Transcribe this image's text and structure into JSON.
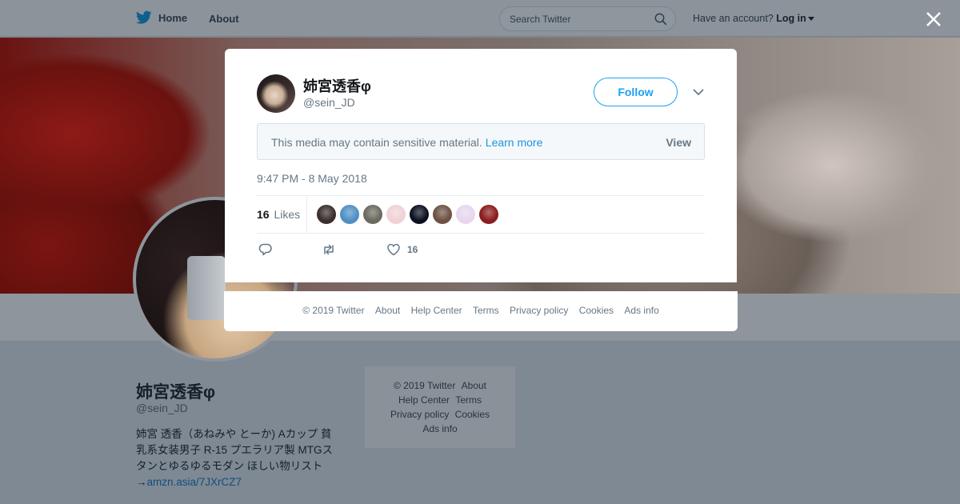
{
  "nav": {
    "home": "Home",
    "about": "About",
    "search_placeholder": "Search Twitter",
    "have_account": "Have an account?",
    "login": "Log in"
  },
  "profile": {
    "name": "姉宮透香φ",
    "handle": "@sein_JD",
    "bio_line1": "姉宮 透香（あねみや とーか) Aカップ 貧",
    "bio_line2": "乳系女装男子 R-15 プエラリア製 MTGス",
    "bio_line3": "タンとゆるゆるモダン ほしい物リスト",
    "bio_arrow": "→",
    "bio_link": "amzn.asia/7JXrCZ7"
  },
  "side_footer": {
    "copyright": "© 2019 Twitter",
    "about": "About",
    "help_center": "Help Center",
    "terms": "Terms",
    "privacy": "Privacy policy",
    "cookies": "Cookies",
    "ads_info": "Ads info"
  },
  "tweet": {
    "author_name": "姉宮透香φ",
    "author_handle": "@sein_JD",
    "follow_label": "Follow",
    "sensitive_text": "This media may contain sensitive material.",
    "learn_more": "Learn more",
    "view_label": "View",
    "timestamp": "9:47 PM - 8 May 2018",
    "likes_count": "16",
    "likes_word": "Likes",
    "like_action_count": "16",
    "likers": [
      {
        "name": "liker-1",
        "color": "#3a2f2c"
      },
      {
        "name": "liker-2",
        "color": "#4f8fc4"
      },
      {
        "name": "liker-3",
        "color": "#6b6a5e"
      },
      {
        "name": "liker-4",
        "color": "#f0d2d6"
      },
      {
        "name": "liker-5",
        "color": "#0b1020"
      },
      {
        "name": "liker-6",
        "color": "#6e5144"
      },
      {
        "name": "liker-7",
        "color": "#e6d7ee"
      },
      {
        "name": "liker-8",
        "color": "#8a1d1d"
      }
    ]
  },
  "modal_footer": {
    "copyright": "© 2019 Twitter",
    "about": "About",
    "help_center": "Help Center",
    "terms": "Terms",
    "privacy": "Privacy policy",
    "cookies": "Cookies",
    "ads_info": "Ads info"
  },
  "colors": {
    "twitter_blue": "#1da1f2",
    "link_blue": "#1b95e0",
    "overlay": "#7f8994"
  }
}
